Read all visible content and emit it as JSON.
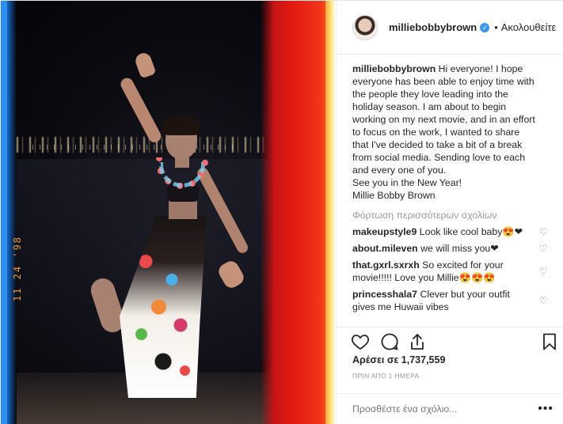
{
  "header": {
    "username": "milliebobbybrown",
    "verified_icon": "verified-badge-icon",
    "separator": "•",
    "follow_status": "Ακολουθείτε"
  },
  "photo": {
    "date_stamp": "11 24 '98"
  },
  "caption": {
    "username": "milliebobbybrown",
    "lines": [
      "Hi everyone! I hope",
      "everyone has been able to enjoy time with",
      "the people they love leading into the",
      "holiday season. I am about to begin",
      "working on my next movie, and in an effort",
      "to focus on the work, I wanted to share",
      "that I've decided to take a bit of a break",
      "from social media. Sending love to each",
      "and every one of you.",
      "See you in the New Year!",
      "Millie Bobby Brown"
    ]
  },
  "load_more": "Φόρτωση περισσότερων σχολίων",
  "comments": [
    {
      "username": "makeupstyle9",
      "text": "Look like cool baby😍❤"
    },
    {
      "username": "about.mileven",
      "text": "we will miss you❤"
    },
    {
      "username": "that.gxrl.sxrxh",
      "text": "So excited for your movie!!!!! Love you Millie😍😍😍"
    },
    {
      "username": "princesshala7",
      "text": "Clever but your outfit gives me Huwaii vibes"
    }
  ],
  "actions": {
    "like_icon": "heart-icon",
    "comment_icon": "comment-icon",
    "share_icon": "share-icon",
    "save_icon": "bookmark-icon"
  },
  "likes": "Αρέσει σε 1,737,559",
  "timestamp": "ΠΡΙΝ ΑΠΟ 1 ΗΜΕΡΑ",
  "add_comment": {
    "placeholder": "Προσθέστε ένα σχόλιο...",
    "more_label": "•••"
  },
  "colors": {
    "accent": "#3897f0",
    "text": "#262626",
    "muted": "#999999"
  }
}
